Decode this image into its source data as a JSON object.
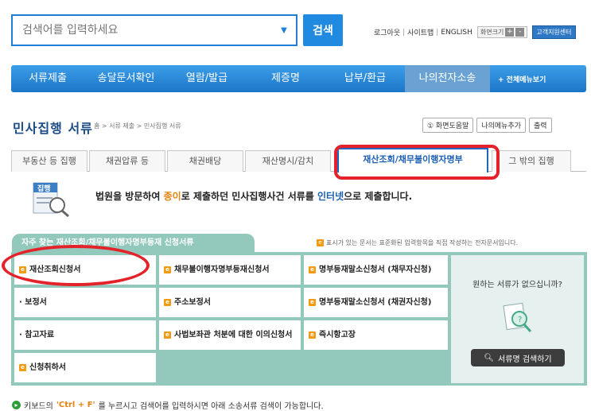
{
  "search": {
    "placeholder": "검색어를 입력하세요",
    "button": "검색"
  },
  "util": {
    "logout": "로그아웃",
    "sitemap": "사이트맵",
    "english": "ENGLISH",
    "zoom": "화면크기",
    "zoom_in": "+",
    "zoom_out": "-",
    "help_center": "고객지원센터"
  },
  "nav": {
    "items": [
      "서류제출",
      "송달문서확인",
      "열람/발급",
      "제증명",
      "납부/환급",
      "나의전자소송"
    ],
    "all_menu": "+ 전체메뉴보기"
  },
  "page": {
    "title": "민사집행 서류",
    "breadcrumb": "홈 > 서류 제출 > 민사집행 서류",
    "tools": [
      "① 화면도움말",
      "나의메뉴추가",
      "출력"
    ]
  },
  "tabs": [
    "부동산 등 집행",
    "채권압류 등",
    "채권배당",
    "재산명시/감치",
    "재산조회/채무불이행자명부",
    "그 밖의 집행"
  ],
  "intro": {
    "icon_label": "집행",
    "t1": "법원을 방문하여 ",
    "t2": "종이",
    "t3": "로 제출하던 민사집행사건 서류를 ",
    "t4": "인터넷",
    "t5": "으로 제출합니다."
  },
  "panel": {
    "tab_title": "자주 찾는 재산조회/채무불이행자명부등재 신청서류",
    "legend_icon": "e",
    "legend": "표시가 있는 문서는 표준화된 입력항목을 직접 작성하는 전자문서입니다.",
    "docs": {
      "c1": "재산조회신청서",
      "c2": "채무불이행자명부등재신청서",
      "c3": "명부등재말소신청서 (채무자신청)",
      "c4": "· 보정서",
      "c5": "주소보정서",
      "c6": "명부등재말소신청서 (채권자신청)",
      "c7": "· 참고자료",
      "c8": "사법보좌관 처분에 대한 이의신청서",
      "c9": "즉시항고장",
      "c10": "신청취하서"
    },
    "side_text": "원하는 서류가 없으십니까?",
    "side_button": "서류명 검색하기"
  },
  "footer": {
    "t1": "키보드의 ",
    "key": "'Ctrl + F'",
    "t2": "를 누르시고 검색어를 입력하시면 아래 소송서류 검색이 가능합니다."
  },
  "colors": {
    "accent": "#1f8ae0",
    "nav": "#1c76c8",
    "panel": "#93c9bd",
    "highlight": "#e4222a",
    "doc_icon": "#f29a11"
  }
}
